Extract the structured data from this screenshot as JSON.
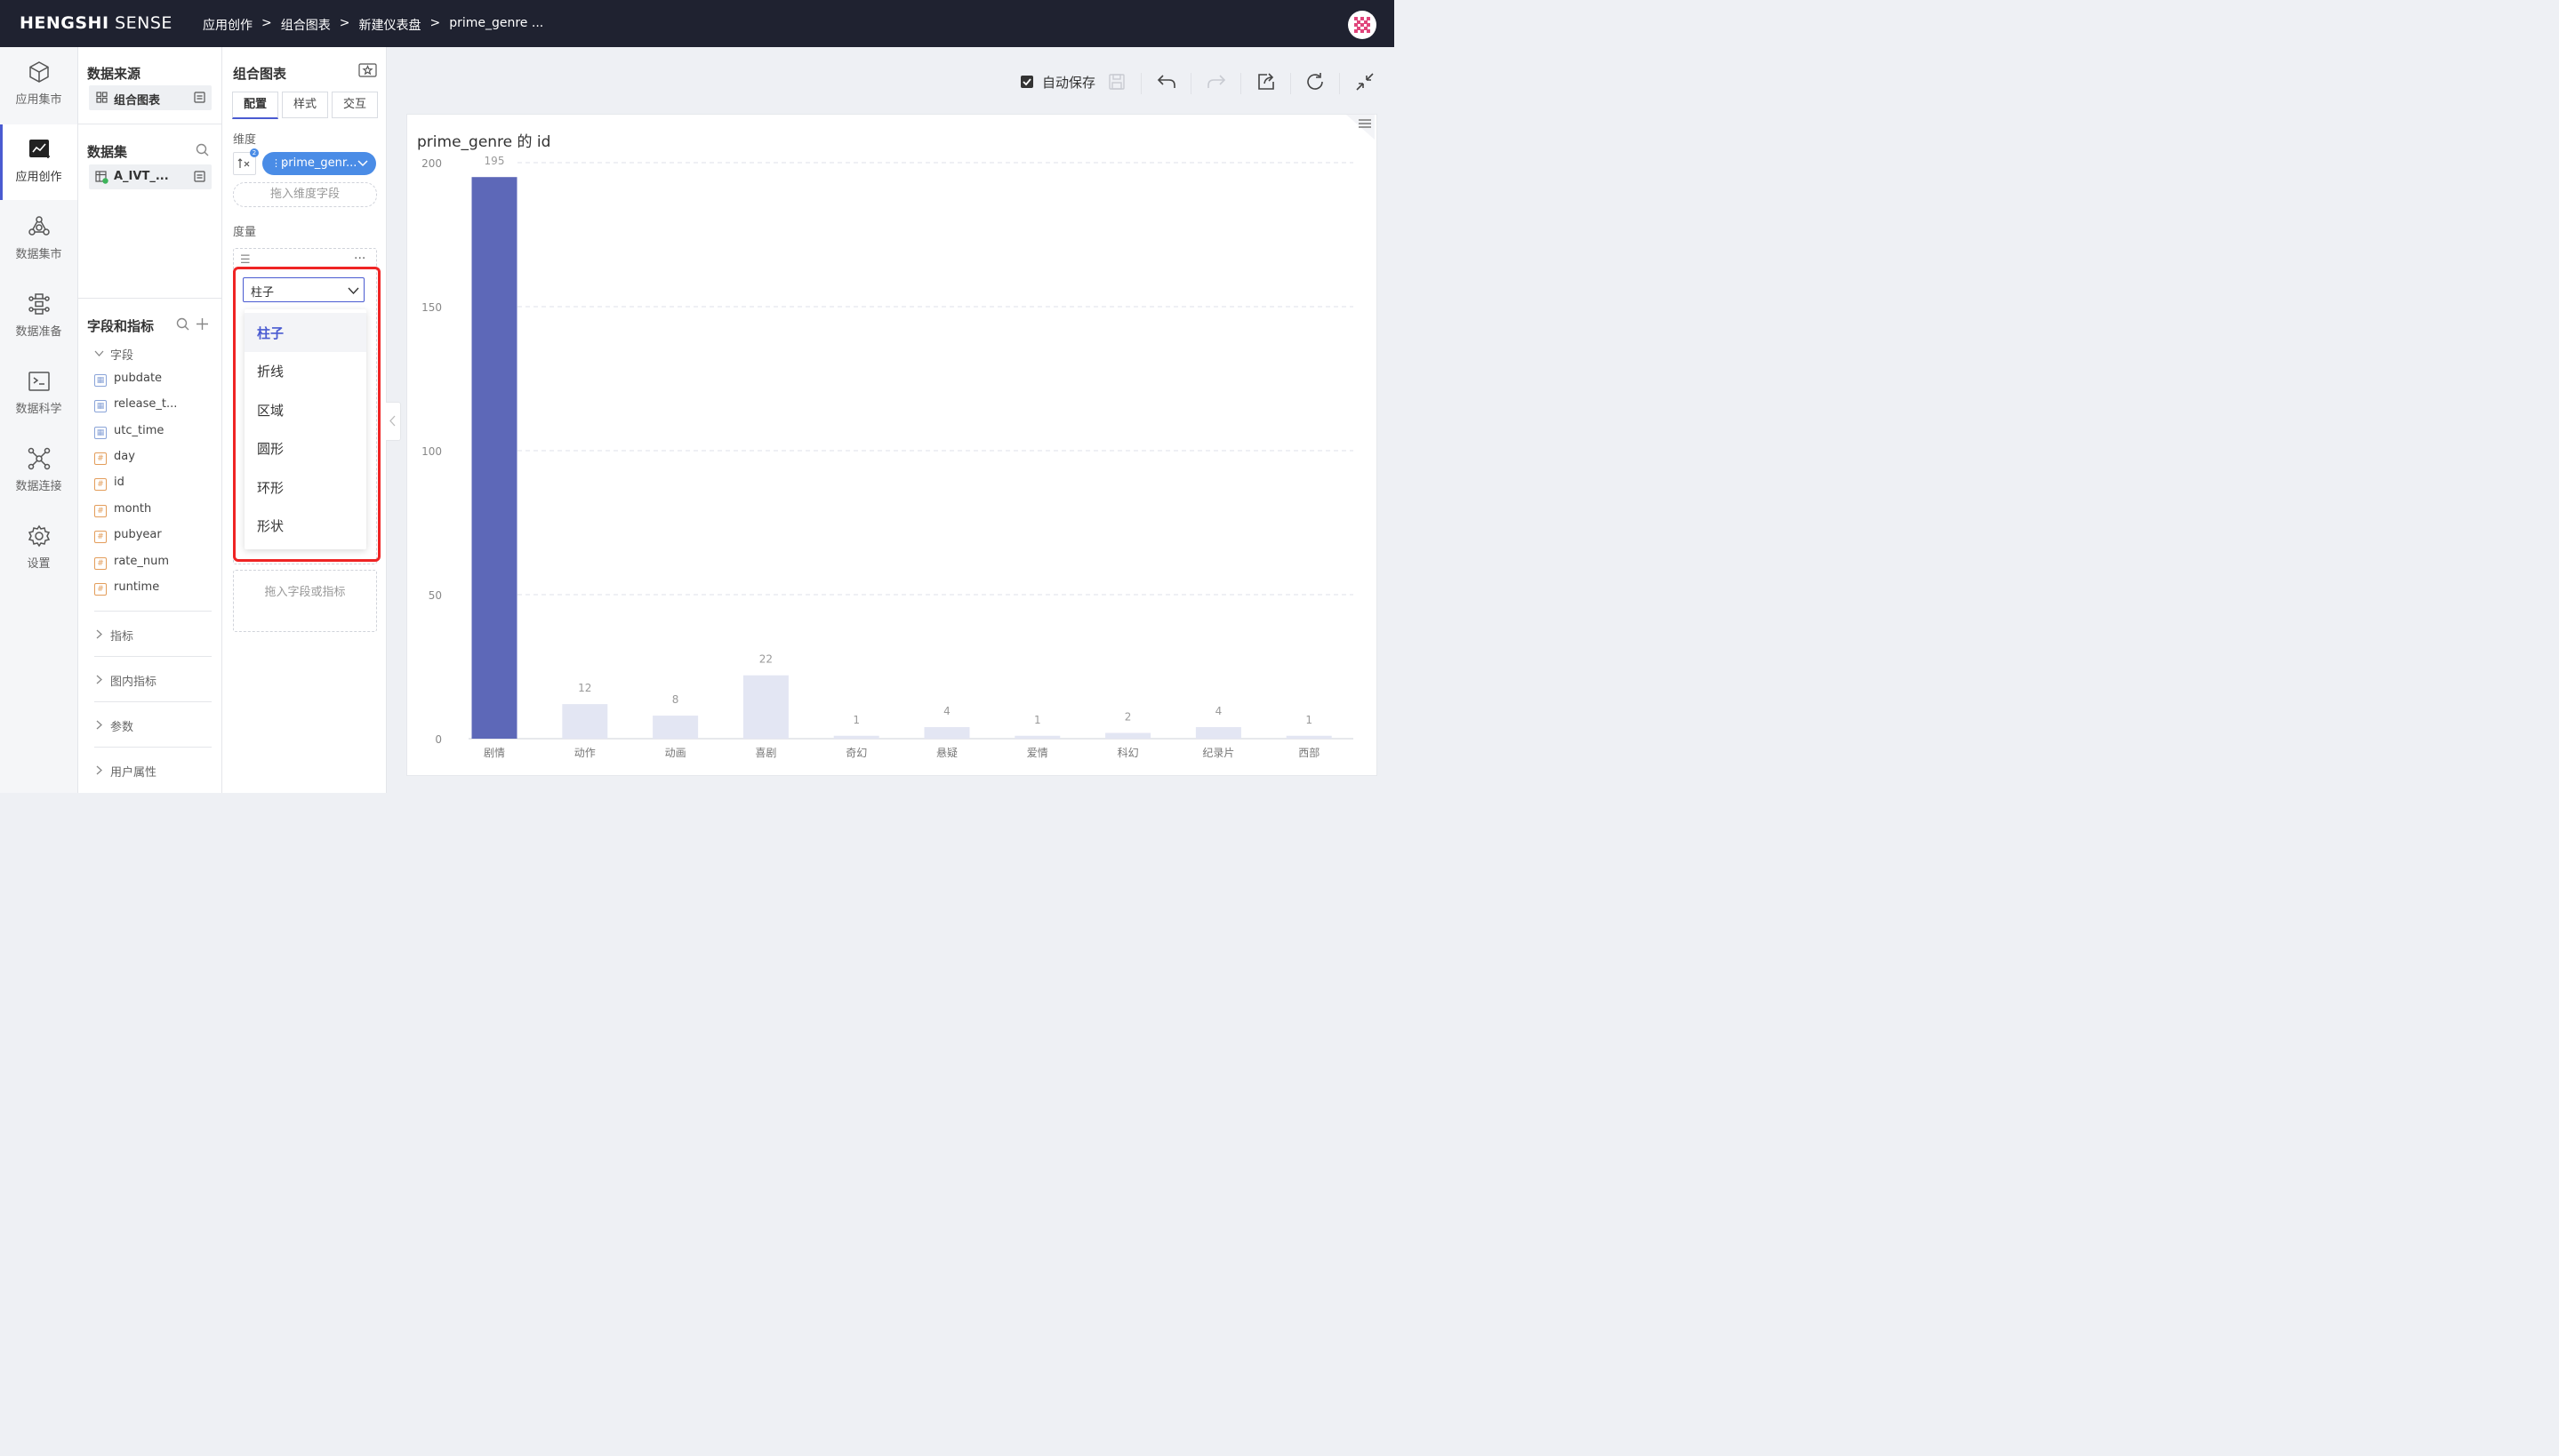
{
  "topbar": {
    "brand_bold": "HENGSHI",
    "brand_light": "SENSE",
    "breadcrumb": [
      "应用创作",
      ">",
      "组合图表",
      ">",
      "新建仪表盘",
      ">",
      "prime_genre ..."
    ]
  },
  "leftnav": {
    "items": [
      {
        "label": "应用集市",
        "icon": "cube-icon"
      },
      {
        "label": "应用创作",
        "icon": "chart-create-icon",
        "active": true
      },
      {
        "label": "数据集市",
        "icon": "dataset-market-icon"
      },
      {
        "label": "数据准备",
        "icon": "data-prep-icon"
      },
      {
        "label": "数据科学",
        "icon": "terminal-icon"
      },
      {
        "label": "数据连接",
        "icon": "connection-icon"
      },
      {
        "label": "设置",
        "icon": "gear-icon"
      }
    ]
  },
  "datasource": {
    "title": "数据来源",
    "chip": "组合图表",
    "dataset_title": "数据集",
    "dataset_chip": "A_IVT_...",
    "fields_title": "字段和指标",
    "fields_group": "字段",
    "fields": [
      {
        "name": "pubdate",
        "type": "date"
      },
      {
        "name": "release_t...",
        "type": "date"
      },
      {
        "name": "utc_time",
        "type": "date"
      },
      {
        "name": "day",
        "type": "number"
      },
      {
        "name": "id",
        "type": "number"
      },
      {
        "name": "month",
        "type": "number"
      },
      {
        "name": "pubyear",
        "type": "number"
      },
      {
        "name": "rate_num",
        "type": "number"
      },
      {
        "name": "runtime",
        "type": "number"
      }
    ],
    "groups": [
      "指标",
      "图内指标",
      "参数",
      "用户属性"
    ]
  },
  "config": {
    "title": "组合图表",
    "tabs": [
      "配置",
      "样式",
      "交互"
    ],
    "dimension_label": "维度",
    "dimension_badge": "2",
    "dimension_pill": "prime_genr...",
    "dimension_drop": "拖入维度字段",
    "measure_label": "度量",
    "select_value": "柱子",
    "options": [
      "柱子",
      "折线",
      "区域",
      "圆形",
      "环形",
      "形状"
    ],
    "bottom_drop": "拖入字段或指标"
  },
  "toolbar": {
    "autosave": "自动保存"
  },
  "chart_data": {
    "type": "bar",
    "title": "prime_genre 的 id",
    "categories": [
      "剧情",
      "动作",
      "动画",
      "喜剧",
      "奇幻",
      "悬疑",
      "爱情",
      "科幻",
      "纪录片",
      "西部"
    ],
    "values": [
      195,
      12,
      8,
      22,
      1,
      4,
      1,
      2,
      4,
      1
    ],
    "value_labels": [
      "195",
      "12",
      "8",
      "22",
      "1",
      "4",
      "1",
      "2",
      "4",
      "1"
    ],
    "ylim": [
      0,
      200
    ],
    "yticks": [
      "0",
      "50",
      "100",
      "150",
      "200"
    ],
    "highlighted_index": 0,
    "colors": {
      "highlight": "#5d68b8",
      "muted": "#e3e6f3"
    },
    "grid": true
  }
}
